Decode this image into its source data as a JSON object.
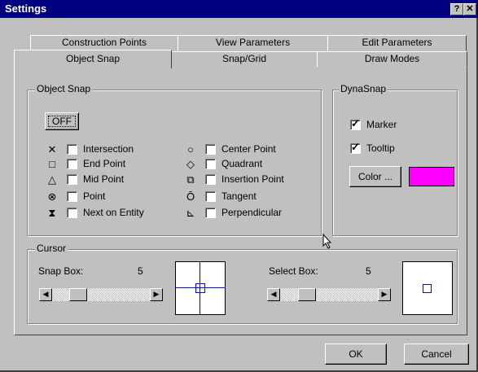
{
  "window": {
    "title": "Settings",
    "help": "?",
    "close": "✕"
  },
  "tabs": {
    "row_back": [
      "Construction Points",
      "View Parameters",
      "Edit Parameters"
    ],
    "row_front": [
      "Object Snap",
      "Snap/Grid",
      "Draw Modes"
    ]
  },
  "object_snap": {
    "group_label": "Object Snap",
    "off_button": "OFF",
    "left": [
      {
        "icon": "cross-icon",
        "symbol": "✕",
        "label": "Intersection",
        "checked": false
      },
      {
        "icon": "square-icon",
        "symbol": "□",
        "label": "End Point",
        "checked": false
      },
      {
        "icon": "triangle-icon",
        "symbol": "△",
        "label": "Mid Point",
        "checked": false
      },
      {
        "icon": "point-icon",
        "symbol": "⊗",
        "label": "Point",
        "checked": false
      },
      {
        "icon": "hourglass-icon",
        "symbol": "⧗",
        "label": "Next on Entity",
        "checked": false
      }
    ],
    "right": [
      {
        "icon": "circle-icon",
        "symbol": "○",
        "label": "Center Point",
        "checked": false
      },
      {
        "icon": "diamond-icon",
        "symbol": "◇",
        "label": "Quadrant",
        "checked": false
      },
      {
        "icon": "insertion-icon",
        "symbol": "⧉",
        "label": "Insertion Point",
        "checked": false
      },
      {
        "icon": "tangent-icon",
        "symbol": "Ō",
        "label": "Tangent",
        "checked": false
      },
      {
        "icon": "perpendicular-icon",
        "symbol": "⊾",
        "label": "Perpendicular",
        "checked": false
      }
    ]
  },
  "dynasnap": {
    "group_label": "DynaSnap",
    "marker_label": "Marker",
    "marker_checked": true,
    "tooltip_label": "Tooltip",
    "tooltip_checked": true,
    "color_button": "Color ...",
    "color": "#ff00ff"
  },
  "cursor": {
    "group_label": "Cursor",
    "snap_box_label": "Snap Box:",
    "snap_box_value": "5",
    "select_box_label": "Select Box:",
    "select_box_value": "5"
  },
  "footer": {
    "ok": "OK",
    "cancel": "Cancel"
  }
}
